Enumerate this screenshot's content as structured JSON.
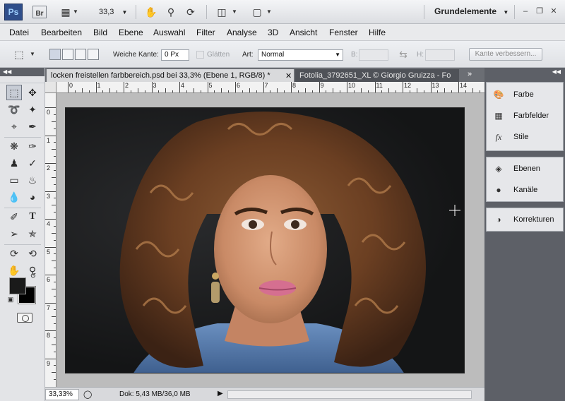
{
  "app": {
    "logo": "Ps",
    "bridge": "Br",
    "zoom": "33,3",
    "workspace": "Grundelemente"
  },
  "menu": [
    "Datei",
    "Bearbeiten",
    "Bild",
    "Ebene",
    "Auswahl",
    "Filter",
    "Analyse",
    "3D",
    "Ansicht",
    "Fenster",
    "Hilfe"
  ],
  "options": {
    "feather_label": "Weiche Kante:",
    "feather_value": "0 Px",
    "antialias_label": "Glätten",
    "style_label": "Art:",
    "style_value": "Normal",
    "width_label": "B:",
    "height_label": "H:",
    "refine_button": "Kante verbessern..."
  },
  "document": {
    "tab_active": "locken freistellen farbbereich.psd bei 33,3% (Ebene 1, RGB/8) *",
    "tab_inactive": "Fotolia_3792651_XL © Giorgio Gruizza - Fo",
    "ruler_h": [
      "0",
      "1",
      "2",
      "3",
      "4",
      "5",
      "6",
      "7",
      "8",
      "9",
      "10",
      "11",
      "12",
      "13",
      "14"
    ],
    "ruler_v": [
      "0",
      "1",
      "2",
      "3",
      "4",
      "5",
      "6",
      "7",
      "8",
      "9"
    ],
    "zoom_status": "33,33%",
    "doc_info": "Dok: 5,43 MB/36,0 MB"
  },
  "panels": {
    "group1": [
      "Farbe",
      "Farbfelder",
      "Stile"
    ],
    "group2": [
      "Ebenen",
      "Kanäle"
    ],
    "group3": [
      "Korrekturen"
    ]
  },
  "colors": {
    "foreground": "#1a1a1a",
    "background": "#000000",
    "panel_dark": "#5d6067"
  }
}
